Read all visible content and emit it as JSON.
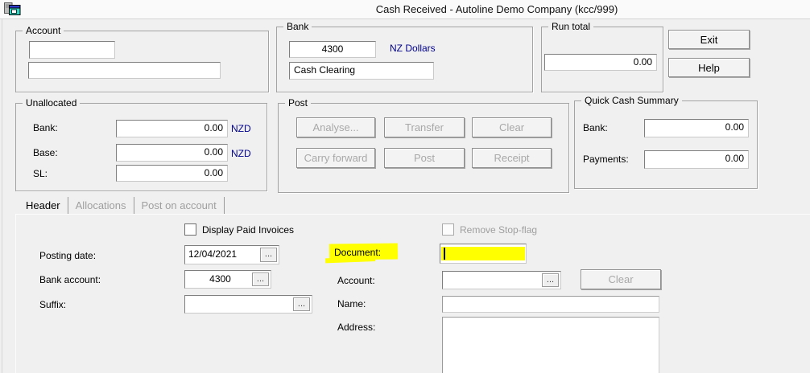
{
  "window": {
    "title": "Cash Received - Autoline Demo Company (kcc/999)",
    "app_icon": "app-window-icon"
  },
  "top": {
    "account_group": {
      "label": "Account",
      "field1": "",
      "field2": ""
    },
    "bank_group": {
      "label": "Bank",
      "code": "4300",
      "currency": "NZ Dollars",
      "name": "Cash Clearing"
    },
    "run_total_group": {
      "label": "Run total",
      "value": "0.00"
    },
    "exit_button": "Exit",
    "help_button": "Help"
  },
  "unallocated": {
    "label": "Unallocated",
    "rows": [
      {
        "label": "Bank:",
        "value": "0.00",
        "currency": "NZD"
      },
      {
        "label": "Base:",
        "value": "0.00",
        "currency": "NZD"
      },
      {
        "label": "SL:",
        "value": "0.00",
        "currency": ""
      }
    ]
  },
  "post": {
    "label": "Post",
    "buttons": [
      "Analyse...",
      "Transfer",
      "Clear",
      "Carry forward",
      "Post",
      "Receipt"
    ]
  },
  "quick_cash": {
    "label": "Quick Cash Summary",
    "rows": [
      {
        "label": "Bank:",
        "value": "0.00"
      },
      {
        "label": "Payments:",
        "value": "0.00"
      }
    ]
  },
  "tabs": [
    {
      "label": "Header",
      "active": true
    },
    {
      "label": "Allocations",
      "active": false
    },
    {
      "label": "Post on account",
      "active": false
    }
  ],
  "form": {
    "display_paid_invoices_label": "Display Paid Invoices",
    "remove_stop_flag_label": "Remove Stop-flag",
    "posting_date": {
      "label": "Posting date:",
      "value": "12/04/2021"
    },
    "bank_account": {
      "label": "Bank account:",
      "value": "4300"
    },
    "suffix": {
      "label": "Suffix:",
      "value": ""
    },
    "document": {
      "label": "Document:",
      "value": ""
    },
    "account": {
      "label": "Account:",
      "value": "",
      "clear_button": "Clear"
    },
    "name": {
      "label": "Name:",
      "value": ""
    },
    "address": {
      "label": "Address:",
      "value": ""
    }
  },
  "ui": {
    "ellipsis": "..."
  },
  "colors": {
    "currency_blue": "#00008b",
    "highlight_yellow": "#ffff00",
    "window_bg": "#f0f0f0"
  }
}
